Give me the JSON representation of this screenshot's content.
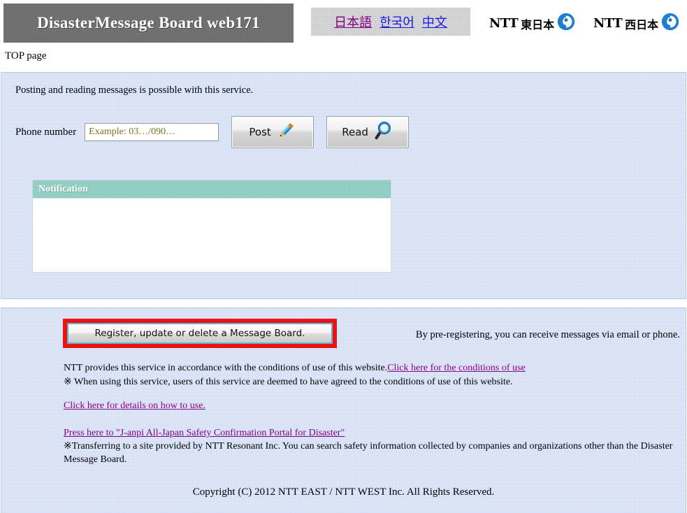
{
  "header": {
    "site_title": "DisasterMessage Board web171",
    "languages": [
      {
        "label": "日本語",
        "state": "visited"
      },
      {
        "label": "한국어",
        "state": "unvisited"
      },
      {
        "label": "中文",
        "state": "unvisited"
      }
    ],
    "logos": [
      {
        "word": "NTT",
        "region": "東日本",
        "name": "ntt-east"
      },
      {
        "word": "NTT",
        "region": "西日本",
        "name": "ntt-west"
      }
    ],
    "breadcrumb": "TOP page"
  },
  "main": {
    "intro": "Posting and reading messages is possible with this service.",
    "phone": {
      "label": "Phone number",
      "value": "",
      "placeholder": "Example: 03…/090…"
    },
    "buttons": {
      "post": {
        "label": "Post",
        "icon": "pencil-icon"
      },
      "read": {
        "label": "Read",
        "icon": "magnifier-icon"
      }
    },
    "notification": {
      "title": "Notification",
      "body": ""
    }
  },
  "secondary": {
    "register_button": "Register, update or delete a Message Board.",
    "prereg_note": "By pre-registering, you can receive messages via email or phone.",
    "terms": {
      "line1_text": "NTT provides this service in accordance with the conditions of use of this website.",
      "line1_link": "Click here for the conditions of use",
      "line2": "※ When using this service, users of this service are deemed to have agreed to the conditions of use of this website."
    },
    "howto_link": "Click here for details on how to use.",
    "janpi": {
      "link": "Press here to \"J-anpi All-Japan Safety Confirmation Portal for Disaster\"",
      "note": "※Transferring to a site provided by NTT Resonant Inc. You can search safety information collected by companies and organizations other than the Disaster Message Board."
    },
    "copyright": "Copyright (C) 2012 NTT EAST / NTT WEST Inc. All Rights Reserved."
  },
  "colors": {
    "title_bar": "#6f6f70",
    "panel_blue": "#d6e2f7",
    "notification_teal": "#92cfc4",
    "highlight_red": "#ee1111",
    "link_visited": "#880088",
    "link_unvisited": "#1a1ae6",
    "ntt_blue": "#1f7fcf",
    "placeholder": "#7a7320"
  }
}
